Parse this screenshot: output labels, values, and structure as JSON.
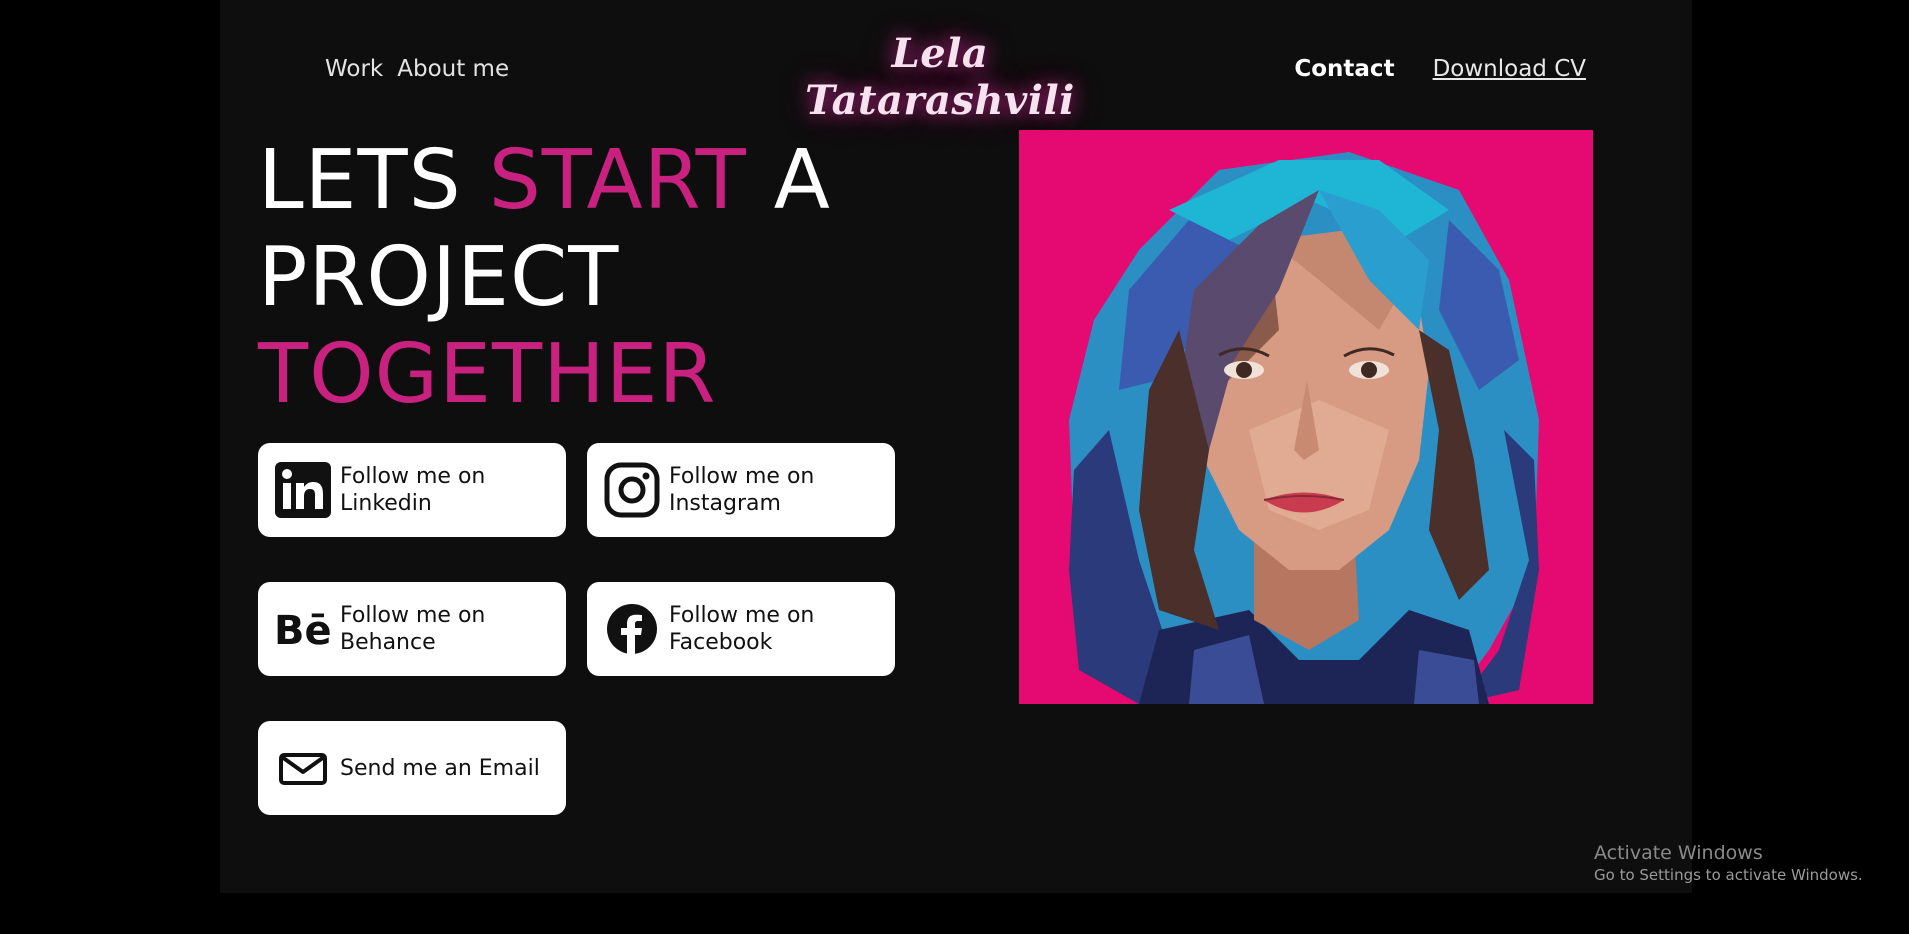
{
  "nav": {
    "work": "Work",
    "about": "About me",
    "contact": "Contact",
    "download_cv": "Download CV"
  },
  "logo": "Lela Tatarashvili",
  "hero": {
    "w1": "LETS",
    "w2": "START",
    "w3": "A",
    "w4": "PROJECT",
    "w5": "TOGETHER",
    "accent_color": "#c9217f"
  },
  "social": [
    {
      "icon": "linkedin-icon",
      "line1": "Follow me on",
      "line2": "Linkedin"
    },
    {
      "icon": "instagram-icon",
      "line1": "Follow me on",
      "line2": "Instagram"
    },
    {
      "icon": "behance-icon",
      "line1": "Follow me on",
      "line2": "Behance"
    },
    {
      "icon": "facebook-icon",
      "line1": "Follow me on",
      "line2": "Facebook"
    }
  ],
  "email": {
    "icon": "mail-icon",
    "label": "Send me an Email"
  },
  "photo": {
    "background": "#e50a72"
  },
  "windows": {
    "title": "Activate Windows",
    "subtitle": "Go to Settings to activate Windows."
  }
}
